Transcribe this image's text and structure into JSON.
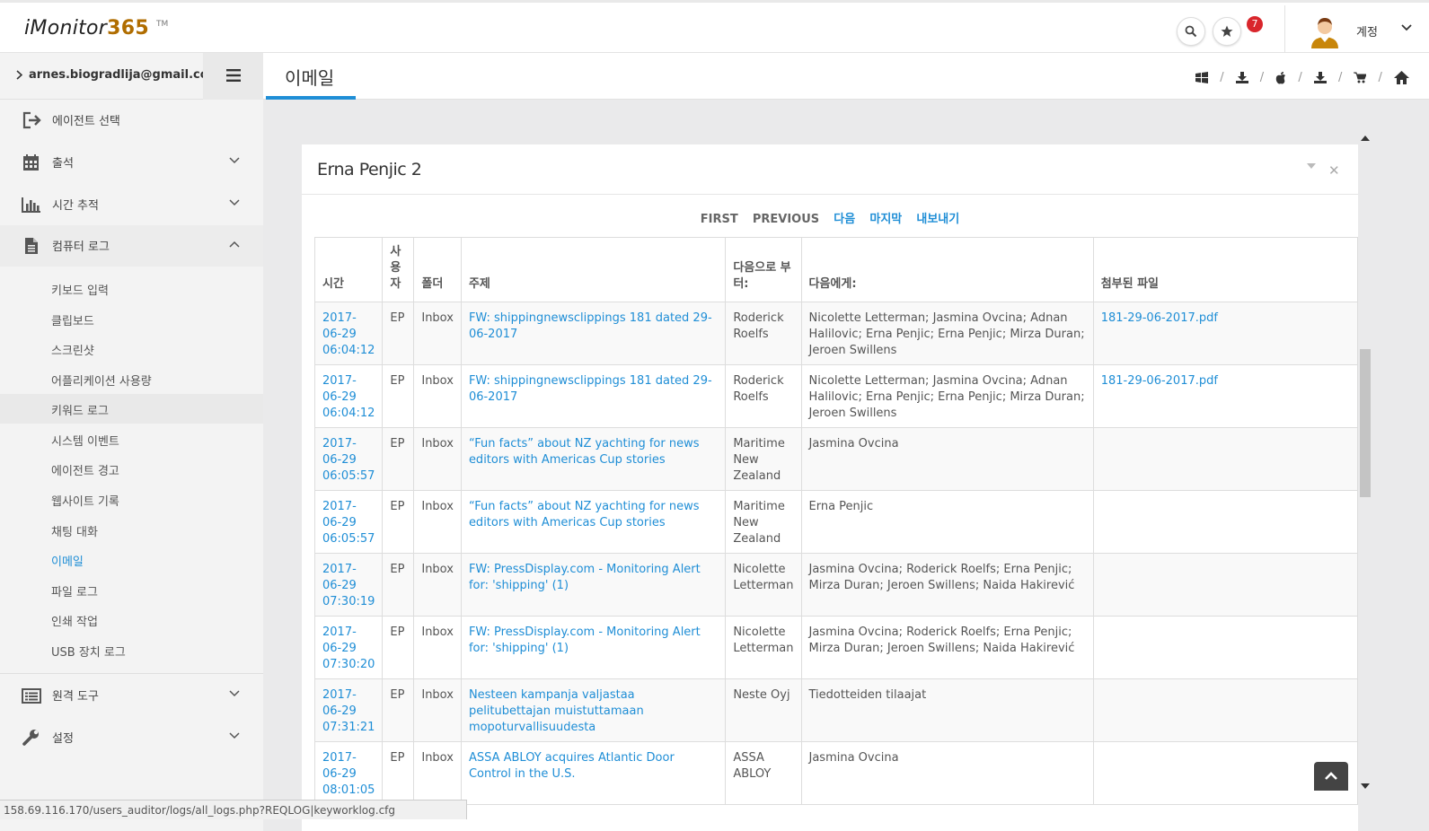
{
  "header": {
    "logo_text": "iMonitor",
    "logo_num": "365",
    "logo_tm": "TM",
    "notification_count": "7",
    "account_label": "계정"
  },
  "sidebar": {
    "user_email": "arnes.biogradlija@gmail.com",
    "items": [
      {
        "label": "에이전트 선택",
        "icon": "sign-in-icon"
      },
      {
        "label": "출석",
        "icon": "calendar-icon"
      },
      {
        "label": "시간 추적",
        "icon": "bar-chart-icon"
      },
      {
        "label": "컴퓨터 로그",
        "icon": "document-icon"
      },
      {
        "label": "원격 도구",
        "icon": "list-icon"
      },
      {
        "label": "설정",
        "icon": "wrench-icon"
      }
    ],
    "subitems": [
      "키보드 입력",
      "클립보드",
      "스크린샷",
      "어플리케이션 사용량",
      "키워드 로그",
      "시스템 이벤트",
      "에이전트 경고",
      "웹사이트 기록",
      "채팅 대화",
      "이메일",
      "파일 로그",
      "인쇄 작업",
      "USB 장치 로그"
    ]
  },
  "page": {
    "title": "이메일",
    "breadcrumb_icons": [
      "windows-icon",
      "download-icon",
      "apple-icon",
      "download-icon",
      "cart-icon",
      "home-icon"
    ]
  },
  "panel": {
    "title": "Erna Penjic 2",
    "pager": {
      "first": "FIRST",
      "previous": "PREVIOUS",
      "next": "다음",
      "last": "마지막",
      "export": "내보내기"
    },
    "columns": [
      "시간",
      "사용자",
      "폴더",
      "주제",
      "다음으로 부터:",
      "다음에게:",
      "첨부된 파일"
    ],
    "rows": [
      {
        "time": "2017-06-29 06:04:12",
        "user": "EP",
        "folder": "Inbox",
        "subject": "FW: shippingnewsclippings 181 dated 29-06-2017",
        "from": "Roderick Roelfs",
        "to": "Nicolette Letterman; Jasmina Ovcina; Adnan Halilovic; Erna Penjic; Erna Penjic; Mirza Duran; Jeroen Swillens",
        "attachment": "181-29-06-2017.pdf"
      },
      {
        "time": "2017-06-29 06:04:12",
        "user": "EP",
        "folder": "Inbox",
        "subject": "FW: shippingnewsclippings 181 dated 29-06-2017",
        "from": "Roderick Roelfs",
        "to": "Nicolette Letterman; Jasmina Ovcina; Adnan Halilovic; Erna Penjic; Erna Penjic; Mirza Duran; Jeroen Swillens",
        "attachment": "181-29-06-2017.pdf"
      },
      {
        "time": "2017-06-29 06:05:57",
        "user": "EP",
        "folder": "Inbox",
        "subject": "“Fun facts” about NZ yachting for news editors with Americas Cup stories",
        "from": "Maritime New Zealand",
        "to": "Jasmina Ovcina",
        "attachment": ""
      },
      {
        "time": "2017-06-29 06:05:57",
        "user": "EP",
        "folder": "Inbox",
        "subject": "“Fun facts” about NZ yachting for news editors with Americas Cup stories",
        "from": "Maritime New Zealand",
        "to": "Erna Penjic",
        "attachment": ""
      },
      {
        "time": "2017-06-29 07:30:19",
        "user": "EP",
        "folder": "Inbox",
        "subject": "FW: PressDisplay.com - Monitoring Alert for: 'shipping' (1)",
        "from": "Nicolette Letterman",
        "to": "Jasmina Ovcina; Roderick Roelfs; Erna Penjic; Mirza Duran; Jeroen Swillens; Naida Hakirević",
        "attachment": ""
      },
      {
        "time": "2017-06-29 07:30:20",
        "user": "EP",
        "folder": "Inbox",
        "subject": "FW: PressDisplay.com - Monitoring Alert for: 'shipping' (1)",
        "from": "Nicolette Letterman",
        "to": "Jasmina Ovcina; Roderick Roelfs; Erna Penjic; Mirza Duran; Jeroen Swillens; Naida Hakirević",
        "attachment": ""
      },
      {
        "time": "2017-06-29 07:31:21",
        "user": "EP",
        "folder": "Inbox",
        "subject": "Nesteen kampanja valjastaa pelitubettajan muistuttamaan mopoturvallisuudesta",
        "from": "Neste Oyj",
        "to": "Tiedotteiden tilaajat",
        "attachment": ""
      },
      {
        "time": "2017-06-29 08:01:05",
        "user": "EP",
        "folder": "Inbox",
        "subject": "ASSA ABLOY acquires Atlantic Door Control in the U.S.",
        "from": "ASSA ABLOY",
        "to": "Jasmina Ovcina",
        "attachment": ""
      }
    ]
  },
  "status_url": "158.69.116.170/users_auditor/logs/all_logs.php?REQLOG|keyworklog.cfg",
  "colors": {
    "accent": "#1f8ed6",
    "badge": "#d9262c",
    "logo_num": "#b06d00"
  }
}
